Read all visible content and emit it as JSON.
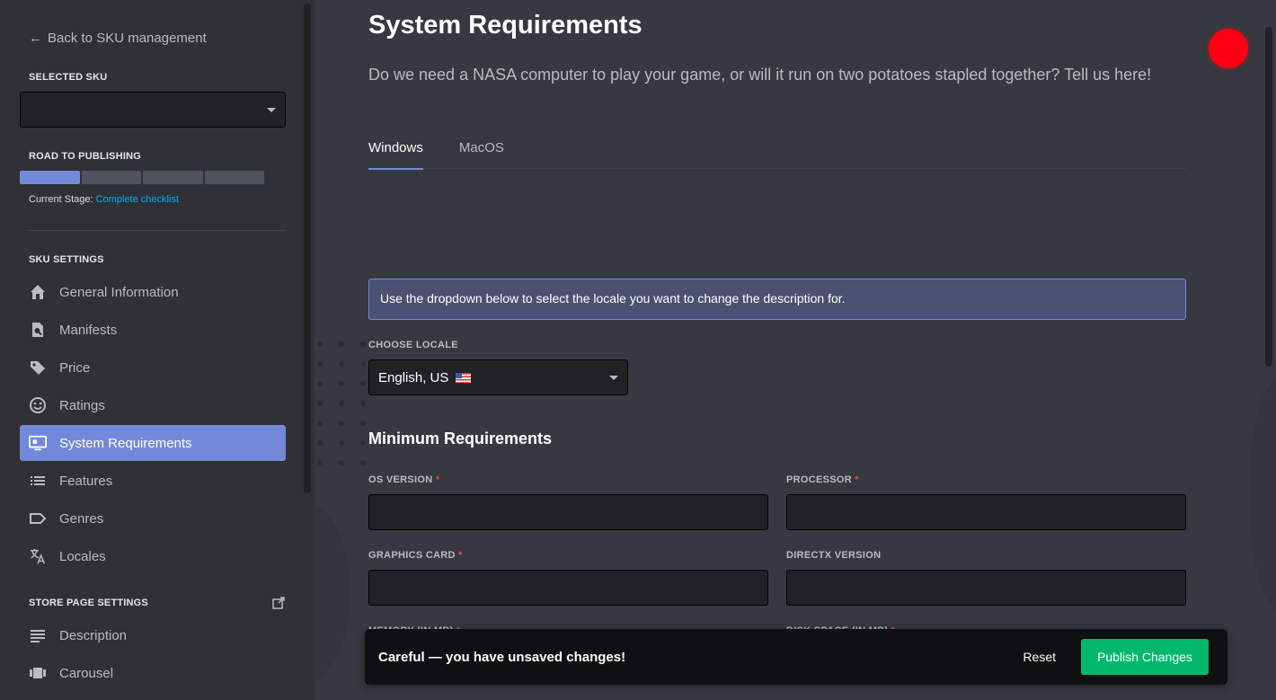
{
  "sidebar": {
    "back_label": "Back to SKU management",
    "selected_sku_heading": "SELECTED SKU",
    "selected_sku_value": "",
    "road_heading": "ROAD TO PUBLISHING",
    "progress": {
      "completed_steps": 1,
      "total_steps": 4
    },
    "current_stage_label": "Current Stage:",
    "current_stage_link": "Complete checklist",
    "sku_settings_heading": "SKU SETTINGS",
    "sku_items": [
      {
        "label": "General Information",
        "icon": "home-icon"
      },
      {
        "label": "Manifests",
        "icon": "file-search-icon"
      },
      {
        "label": "Price",
        "icon": "tag-icon"
      },
      {
        "label": "Ratings",
        "icon": "smiley-icon"
      },
      {
        "label": "System Requirements",
        "icon": "monitor-icon",
        "active": true
      },
      {
        "label": "Features",
        "icon": "list-icon"
      },
      {
        "label": "Genres",
        "icon": "label-icon"
      },
      {
        "label": "Locales",
        "icon": "translate-icon"
      }
    ],
    "store_settings_heading": "STORE PAGE SETTINGS",
    "store_items": [
      {
        "label": "Description",
        "icon": "text-lines-icon"
      },
      {
        "label": "Carousel",
        "icon": "carousel-icon"
      }
    ]
  },
  "main": {
    "title": "System Requirements",
    "description": "Do we need a NASA computer to play your game, or will it run on two potatoes stapled together? Tell us here!",
    "tabs": [
      {
        "label": "Windows",
        "active": true
      },
      {
        "label": "MacOS",
        "active": false
      }
    ],
    "info_message": "Use the dropdown below to select the locale you want to change the description for.",
    "locale_label": "CHOOSE LOCALE",
    "locale_value": "English, US",
    "section_title": "Minimum Requirements",
    "fields": {
      "os_version": {
        "label": "OS VERSION",
        "required": "*",
        "value": ""
      },
      "processor": {
        "label": "PROCESSOR",
        "required": "*",
        "value": ""
      },
      "graphics_card": {
        "label": "GRAPHICS CARD",
        "required": "*",
        "value": ""
      },
      "directx_version": {
        "label": "DIRECTX VERSION",
        "value": ""
      },
      "memory": {
        "label": "MEMORY (IN MB)",
        "required": "*"
      },
      "disk_space": {
        "label": "DISK SPACE (IN MB)",
        "required": "*"
      }
    }
  },
  "notice": {
    "message": "Careful — you have unsaved changes!",
    "reset_label": "Reset",
    "publish_label": "Publish Changes"
  },
  "colors": {
    "accent": "#7289da",
    "publish": "#03b86b",
    "required": "#f04747",
    "link": "#00b0f4"
  }
}
